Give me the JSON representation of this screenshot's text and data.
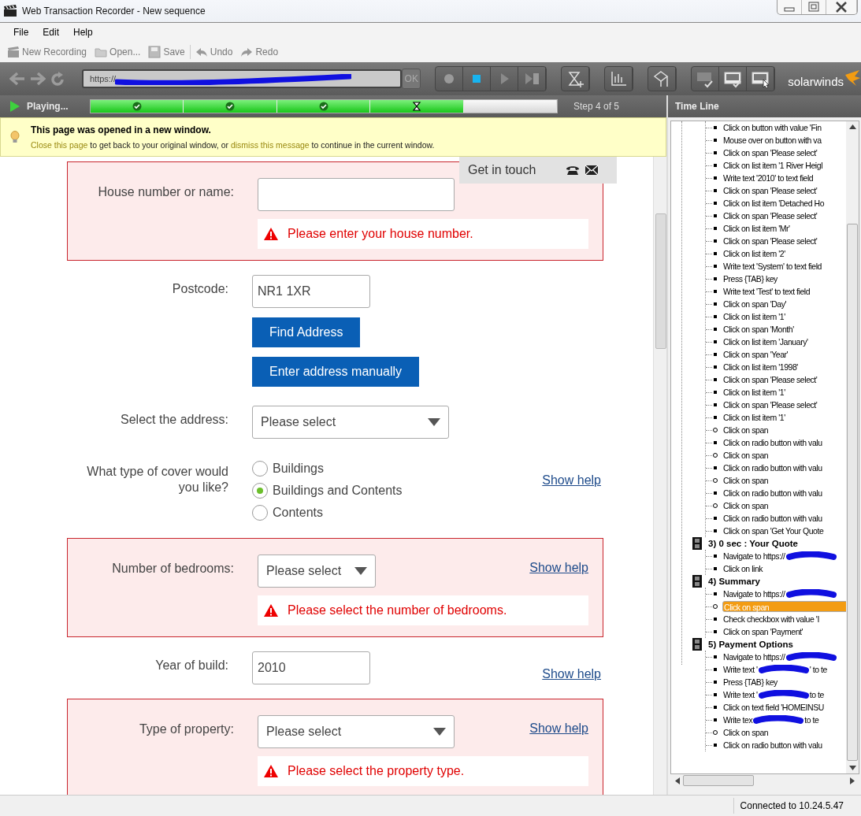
{
  "window": {
    "title": "Web Transaction Recorder - New sequence"
  },
  "menu": [
    "File",
    "Edit",
    "Help"
  ],
  "toolbar": [
    {
      "label": "New Recording",
      "kind": "recording"
    },
    {
      "label": "Open...",
      "kind": "open"
    },
    {
      "label": "Save",
      "kind": "save"
    },
    {
      "label": "Undo",
      "kind": "undo"
    },
    {
      "label": "Redo",
      "kind": "redo"
    }
  ],
  "address_bar": {
    "value": "https://",
    "button": "OK"
  },
  "brand": "solarwinds",
  "player": {
    "status": "Playing...",
    "step_label": "Step 4 of 5",
    "level": 0.8,
    "steps": [
      {
        "kind": "done"
      },
      {
        "kind": "done"
      },
      {
        "kind": "done"
      },
      {
        "kind": "running"
      },
      {
        "kind": "pending"
      }
    ]
  },
  "notice": {
    "title": "This page was opened in a new window.",
    "link_1": "Close this page",
    "text_1": "to get back to your original window, or",
    "link_2": "dismiss this message",
    "text_2": "to continue in the current window."
  },
  "contact_tab": {
    "label": "Get in touch"
  },
  "form": {
    "rows": [
      {
        "kind": "text",
        "label": "House number or name:",
        "value": "",
        "error": true,
        "error_message": "Please enter your house number."
      },
      {
        "kind": "text",
        "label": "Postcode:",
        "value": "NR1 1XR",
        "error": false,
        "buttons": [
          "Find Address",
          "Enter address manually"
        ]
      },
      {
        "kind": "select",
        "label": "Select the address:",
        "value": "Please select",
        "error": false
      },
      {
        "kind": "radio",
        "label": "What type of cover would you like?",
        "error": false,
        "help": "Show help",
        "options": [
          {
            "label": "Buildings",
            "selected": false
          },
          {
            "label": "Buildings and Contents",
            "selected": true
          },
          {
            "label": "Contents",
            "selected": false
          }
        ]
      },
      {
        "kind": "select",
        "label": "Number of bedrooms:",
        "value": "Please select",
        "error": true,
        "help": "Show help",
        "error_message": "Please select the number of bedrooms."
      },
      {
        "kind": "text",
        "label": "Year of build:",
        "value": "2010",
        "error": false,
        "help": "Show help"
      },
      {
        "kind": "select",
        "label": "Type of property:",
        "value": "Please select",
        "error": true,
        "help": "Show help",
        "error_message": "Please select the property type."
      }
    ]
  },
  "timeline": {
    "title": "Time Line",
    "steps": [
      {
        "children": [
          {
            "text": "Click on button with value 'Fin",
            "kind": "square",
            "selected": false
          },
          {
            "text": "Mouse over on button with va",
            "kind": "square",
            "selected": false
          },
          {
            "text": "Click on span 'Please select'",
            "kind": "square",
            "selected": false
          },
          {
            "text": "Click on list item '1 River Heigl",
            "kind": "square",
            "selected": false
          },
          {
            "text": "Write text '2010' to text field",
            "kind": "square",
            "selected": false
          },
          {
            "text": "Click on span 'Please select'",
            "kind": "square",
            "selected": false
          },
          {
            "text": "Click on list item 'Detached Ho",
            "kind": "square",
            "selected": false
          },
          {
            "text": "Click on span 'Please select'",
            "kind": "square",
            "selected": false
          },
          {
            "text": "Click on list item 'Mr'",
            "kind": "square",
            "selected": false
          },
          {
            "text": "Click on span 'Please select'",
            "kind": "square",
            "selected": false
          },
          {
            "text": "Click on list item '2'",
            "kind": "square",
            "selected": false
          },
          {
            "text": "Write text 'System' to text field",
            "kind": "square",
            "selected": false
          },
          {
            "text": "Press {TAB} key",
            "kind": "square",
            "selected": false
          },
          {
            "text": "Write text 'Test' to text field",
            "kind": "square",
            "selected": false
          },
          {
            "text": "Click on span 'Day'",
            "kind": "square",
            "selected": false
          },
          {
            "text": "Click on list item '1'",
            "kind": "square",
            "selected": false
          },
          {
            "text": "Click on span 'Month'",
            "kind": "square",
            "selected": false
          },
          {
            "text": "Click on list item 'January'",
            "kind": "square",
            "selected": false
          },
          {
            "text": "Click on span 'Year'",
            "kind": "square",
            "selected": false
          },
          {
            "text": "Click on list item '1998'",
            "kind": "square",
            "selected": false
          },
          {
            "text": "Click on span 'Please select'",
            "kind": "square",
            "selected": false
          },
          {
            "text": "Click on list item '1'",
            "kind": "square",
            "selected": false
          },
          {
            "text": "Click on span 'Please select'",
            "kind": "square",
            "selected": false
          },
          {
            "text": "Click on list item '1'",
            "kind": "square",
            "selected": false
          },
          {
            "text": "Click on span",
            "kind": "circle",
            "selected": false
          },
          {
            "text": "Click on radio button with valu",
            "kind": "square",
            "selected": false
          },
          {
            "text": "Click on span",
            "kind": "circle",
            "selected": false
          },
          {
            "text": "Click on radio button with valu",
            "kind": "square",
            "selected": false
          },
          {
            "text": "Click on span",
            "kind": "circle",
            "selected": false
          },
          {
            "text": "Click on radio button with valu",
            "kind": "square",
            "selected": false
          },
          {
            "text": "Click on span",
            "kind": "circle",
            "selected": false
          },
          {
            "text": "Click on radio button with valu",
            "kind": "square",
            "selected": false
          },
          {
            "text": "Click on span 'Get Your Quote",
            "kind": "square",
            "selected": false
          }
        ]
      },
      {
        "title": "3) 0 sec : Your Quote",
        "children": [
          {
            "text": "Navigate to https://",
            "kind": "square",
            "selected": false,
            "redacted": true
          },
          {
            "text": "Click on link",
            "kind": "square",
            "selected": false
          }
        ]
      },
      {
        "title": "4) Summary",
        "children": [
          {
            "text": "Navigate to https://",
            "kind": "square",
            "selected": false,
            "redacted": true
          },
          {
            "text": "Click on span",
            "kind": "circle",
            "selected": true
          },
          {
            "text": "Check checkbox with value 'I",
            "kind": "square",
            "selected": false
          },
          {
            "text": "Click on span 'Payment'",
            "kind": "square",
            "selected": false
          }
        ]
      },
      {
        "title": "5) Payment Options",
        "children": [
          {
            "text": "Navigate to https://",
            "kind": "square",
            "selected": false,
            "redacted": true
          },
          {
            "text": "Write text '",
            "kind": "square",
            "selected": false,
            "redacted": true,
            "text_after": "' to te"
          },
          {
            "text": "Press {TAB} key",
            "kind": "square",
            "selected": false
          },
          {
            "text": "Write text '",
            "kind": "square",
            "selected": false,
            "redacted": true,
            "text_after": "to te"
          },
          {
            "text": "Click on text field 'HOMEINSU",
            "kind": "square",
            "selected": false
          },
          {
            "text": "Write tex",
            "kind": "square",
            "selected": false,
            "redacted": true,
            "text_after": "to te"
          },
          {
            "text": "Click on span",
            "kind": "circle",
            "selected": false
          },
          {
            "text": "Click on radio button with valu",
            "kind": "square",
            "selected": false
          }
        ]
      }
    ]
  },
  "status_bar": {
    "text": "Connected to 10.24.5.47"
  }
}
